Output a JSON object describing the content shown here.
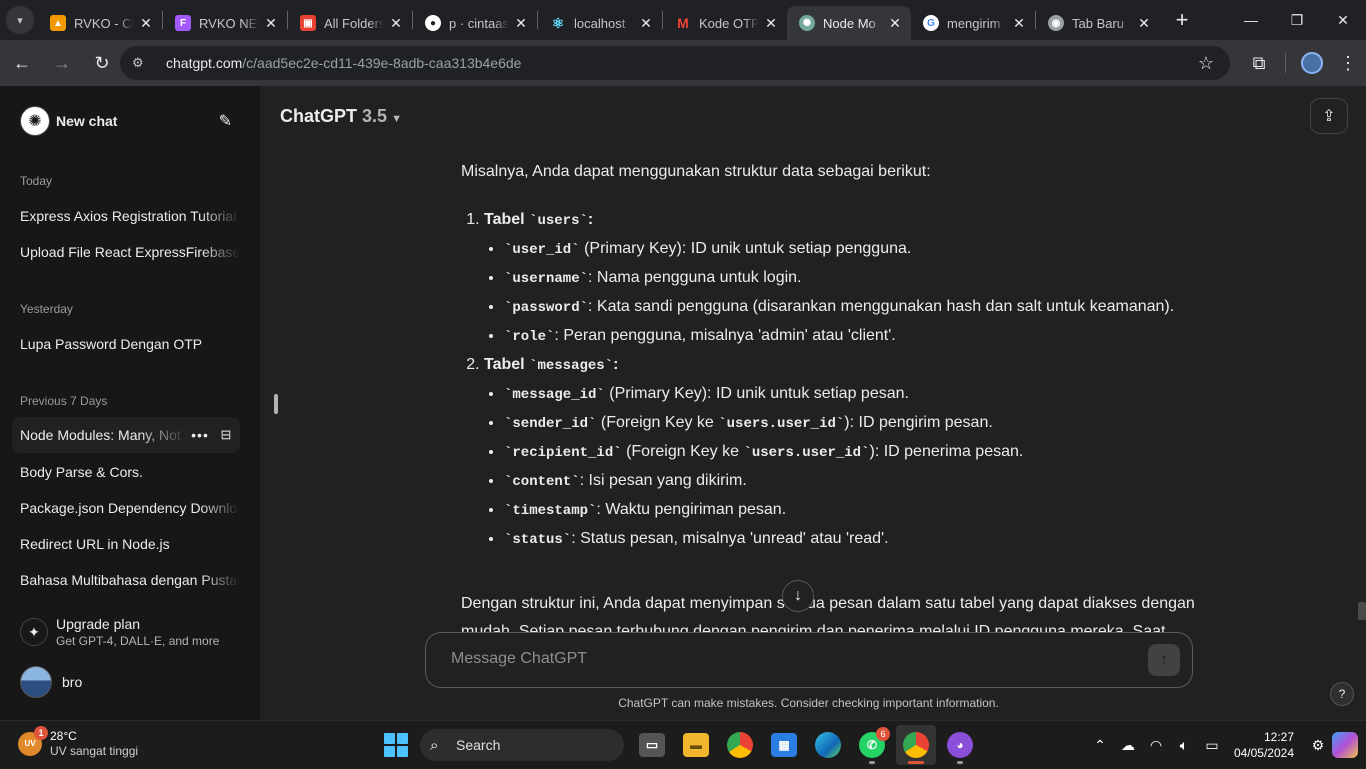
{
  "browser": {
    "tabs": [
      {
        "title": "RVKO - Cl",
        "favicon": "flame-icon",
        "color": "#f29900",
        "active": false
      },
      {
        "title": "RVKO NEW",
        "favicon": "figma-icon",
        "color": "#a259ff",
        "active": false
      },
      {
        "title": "All Folders",
        "favicon": "folder-app-icon",
        "color": "#e94235",
        "active": false
      },
      {
        "title": "p · cintaas",
        "favicon": "github-icon",
        "color": "#ffffff",
        "active": false
      },
      {
        "title": "localhost",
        "favicon": "react-icon",
        "color": "#61dafb",
        "active": false
      },
      {
        "title": "Kode OTP",
        "favicon": "gmail-icon",
        "color": "#ea4335",
        "active": false
      },
      {
        "title": "Node Mo",
        "favicon": "chatgpt-icon",
        "color": "#74aa9c",
        "active": true
      },
      {
        "title": "mengirim",
        "favicon": "google-icon",
        "color": "#4285f4",
        "active": false
      },
      {
        "title": "Tab Baru",
        "favicon": "chrome-icon",
        "color": "#9aa0a6",
        "active": false
      }
    ],
    "address": {
      "host": "chatgpt.com",
      "path": "/c/aad5ec2e-cd11-439e-8adb-caa313b4e6de"
    }
  },
  "sidebar": {
    "new_chat_label": "New chat",
    "groups": {
      "today": "Today",
      "yesterday": "Yesterday",
      "previous": "Previous 7 Days"
    },
    "items": [
      "Express Axios Registration Tutorial",
      "Upload File React ExpressFirebase",
      "Lupa Password Dengan OTP",
      "Node Modules: Many, Not Few",
      "Body Parse & Cors.",
      "Package.json Dependency Download",
      "Redirect URL in Node.js",
      "Bahasa Multibahasa dengan Pustaka"
    ],
    "upgrade": {
      "title": "Upgrade plan",
      "subtitle": "Get GPT-4, DALL·E, and more"
    },
    "user_name": "bro"
  },
  "main": {
    "model_name": "ChatGPT",
    "model_version": "3.5",
    "intro": "Misalnya, Anda dapat menggunakan struktur data sebagai berikut:",
    "table_prefix": "Tabel",
    "tables": [
      {
        "name": "`users`",
        "fields": [
          {
            "code": "`user_id`",
            "desc": " (Primary Key): ID unik untuk setiap pengguna."
          },
          {
            "code": "`username`",
            "desc": ": Nama pengguna untuk login."
          },
          {
            "code": "`password`",
            "desc": ": Kata sandi pengguna (disarankan menggunakan hash dan salt untuk keamanan)."
          },
          {
            "code": "`role`",
            "desc": ": Peran pengguna, misalnya 'admin' atau 'client'."
          }
        ]
      },
      {
        "name": "`messages`",
        "fields": [
          {
            "code": "`message_id`",
            "desc": " (Primary Key): ID unik untuk setiap pesan."
          },
          {
            "code": "`sender_id`",
            "desc": " (Foreign Key ke ",
            "code2": "`users.user_id`",
            "desc2": "): ID pengirim pesan."
          },
          {
            "code": "`recipient_id`",
            "desc": " (Foreign Key ke ",
            "code2": "`users.user_id`",
            "desc2": "): ID penerima pesan."
          },
          {
            "code": "`content`",
            "desc": ": Isi pesan yang dikirim."
          },
          {
            "code": "`timestamp`",
            "desc": ": Waktu pengiriman pesan."
          },
          {
            "code": "`status`",
            "desc": ": Status pesan, misalnya 'unread' atau 'read'."
          }
        ]
      }
    ],
    "outro": "Dengan struktur ini, Anda dapat menyimpan semua pesan dalam satu tabel yang dapat diakses dengan mudah. Setiap pesan terhubung dengan pengirim dan penerima melalui ID pengguna mereka. Saat",
    "composer_placeholder": "Message ChatGPT",
    "disclaimer": "ChatGPT can make mistakes. Consider checking important information.",
    "help_label": "?"
  },
  "taskbar": {
    "weather": {
      "temp": "28°C",
      "desc": "UV sangat tinggi",
      "badge": "1"
    },
    "search_label": "Search",
    "apps": [
      {
        "name": "task-view-icon",
        "badge": ""
      },
      {
        "name": "file-explorer-icon",
        "badge": ""
      },
      {
        "name": "chrome-icon",
        "badge": ""
      },
      {
        "name": "microsoft-store-icon",
        "badge": ""
      },
      {
        "name": "edge-icon",
        "badge": ""
      },
      {
        "name": "whatsapp-icon",
        "badge": "6"
      },
      {
        "name": "chrome-profile-icon",
        "badge": ""
      },
      {
        "name": "github-desktop-icon",
        "badge": ""
      }
    ],
    "time": "12:27",
    "date": "04/05/2024"
  }
}
